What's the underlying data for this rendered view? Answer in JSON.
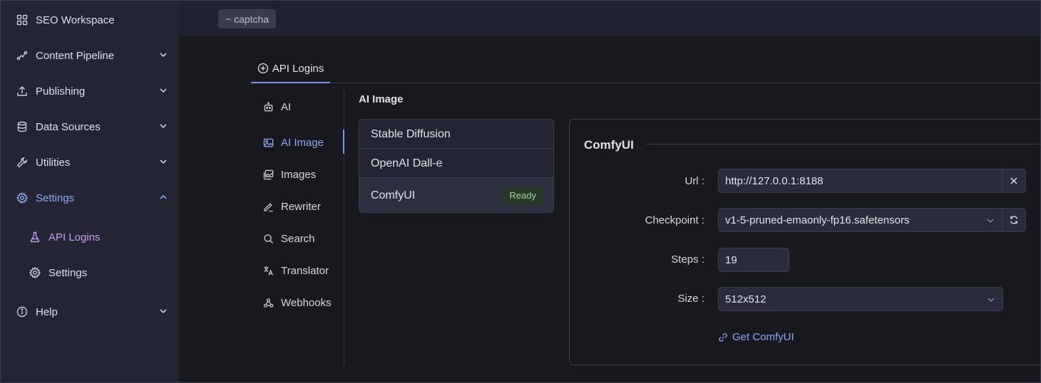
{
  "sidebar": {
    "items": [
      {
        "label": "SEO Workspace",
        "icon": "grid-icon"
      },
      {
        "label": "Content Pipeline",
        "icon": "pipeline-icon"
      },
      {
        "label": "Publishing",
        "icon": "upload-icon"
      },
      {
        "label": "Data Sources",
        "icon": "database-icon"
      },
      {
        "label": "Utilities",
        "icon": "wrench-icon"
      },
      {
        "label": "Settings",
        "icon": "gear-icon"
      },
      {
        "label": "API Logins",
        "icon": "flask-icon"
      },
      {
        "label": "Settings",
        "icon": "gear-icon"
      },
      {
        "label": "Help",
        "icon": "info-icon"
      }
    ]
  },
  "topbar": {
    "breadcrumb": "~ captcha"
  },
  "tabs": [
    {
      "label": "API Logins",
      "icon": "plus-circle-icon"
    }
  ],
  "submenu": {
    "items": [
      {
        "label": "AI",
        "icon": "robot-icon"
      },
      {
        "label": "AI Image",
        "icon": "image-icon"
      },
      {
        "label": "Images",
        "icon": "images-icon"
      },
      {
        "label": "Rewriter",
        "icon": "pen-icon"
      },
      {
        "label": "Search",
        "icon": "search-icon"
      },
      {
        "label": "Translator",
        "icon": "translate-icon"
      },
      {
        "label": "Webhooks",
        "icon": "webhook-icon"
      }
    ]
  },
  "section_title": "AI Image",
  "providers": [
    {
      "label": "Stable Diffusion"
    },
    {
      "label": "OpenAI Dall-e"
    },
    {
      "label": "ComfyUI",
      "badge": "Ready"
    }
  ],
  "panel": {
    "title": "ComfyUI",
    "url": {
      "label": "Url",
      "value": "http://127.0.0.1:8188"
    },
    "checkpoint": {
      "label": "Checkpoint",
      "value": "v1-5-pruned-emaonly-fp16.safetensors"
    },
    "steps": {
      "label": "Steps",
      "value": "19"
    },
    "size": {
      "label": "Size",
      "value": "512x512"
    },
    "link": "Get ComfyUI"
  },
  "colors": {
    "accent": "#8ea8f0",
    "sub_active": "#c79cf2",
    "badge_text": "#9ed59a",
    "badge_bg": "#27382b"
  }
}
